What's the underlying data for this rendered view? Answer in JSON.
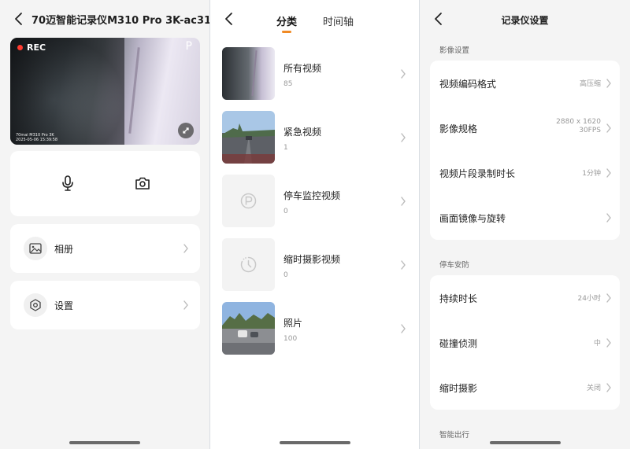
{
  "panel_device": {
    "title": "70迈智能记录仪M310 Pro 3K-ac31",
    "preview": {
      "rec_label": "REC",
      "p_label": "P",
      "brand_overlay": "70mai M310 Pro 3K",
      "timestamp": "2025-05-06 15:39:58"
    },
    "controls": {
      "mic_icon": "microphone-icon",
      "camera_icon": "camera-icon"
    },
    "menu": [
      {
        "label": "相册",
        "icon": "image-icon"
      },
      {
        "label": "设置",
        "icon": "hexagon-settings-icon"
      }
    ]
  },
  "panel_album": {
    "tabs": [
      {
        "label": "分类",
        "active": true
      },
      {
        "label": "时间轴",
        "active": false
      }
    ],
    "categories": [
      {
        "name": "所有视频",
        "count": "85",
        "thumb": "dashcam-photo"
      },
      {
        "name": "紧急视频",
        "count": "1",
        "thumb": "road-photo"
      },
      {
        "name": "停车监控视频",
        "count": "0",
        "thumb": "parking-p-icon"
      },
      {
        "name": "缩时摄影视频",
        "count": "0",
        "thumb": "timelapse-icon"
      },
      {
        "name": "照片",
        "count": "100",
        "thumb": "parking-lot-photo"
      }
    ]
  },
  "panel_settings": {
    "title": "记录仪设置",
    "sections": [
      {
        "title": "影像设置",
        "rows": [
          {
            "label": "视频编码格式",
            "value": "高压缩",
            "value2": ""
          },
          {
            "label": "影像规格",
            "value": "2880 x 1620",
            "value2": "30FPS"
          },
          {
            "label": "视频片段录制时长",
            "value": "1分钟",
            "value2": ""
          },
          {
            "label": "画面镜像与旋转",
            "value": "",
            "value2": ""
          }
        ]
      },
      {
        "title": "停车安防",
        "rows": [
          {
            "label": "持续时长",
            "value": "24小时",
            "value2": ""
          },
          {
            "label": "碰撞侦测",
            "value": "中",
            "value2": ""
          },
          {
            "label": "缩时摄影",
            "value": "关闭",
            "value2": ""
          }
        ]
      },
      {
        "title": "智能出行",
        "rows": []
      }
    ]
  },
  "colors": {
    "accent": "#f08a24",
    "rec_dot": "#ff3b30",
    "background": "#f4f4f4",
    "card": "#ffffff"
  }
}
